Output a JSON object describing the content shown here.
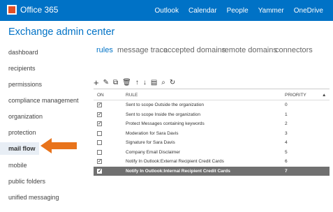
{
  "topbar": {
    "brand": "Office 365",
    "nav": [
      "Outlook",
      "Calendar",
      "People",
      "Yammer",
      "OneDrive"
    ]
  },
  "app_title": "Exchange admin center",
  "sidebar": {
    "items": [
      "dashboard",
      "recipients",
      "permissions",
      "compliance management",
      "organization",
      "protection",
      "mail flow",
      "mobile",
      "public folders",
      "unified messaging"
    ],
    "active": "mail flow"
  },
  "tabs": [
    "rules",
    "message trace",
    "accepted domains",
    "remote domains",
    "connectors"
  ],
  "toolbar": [
    "+",
    "✎",
    "⧉",
    "🗑",
    "↑",
    "↓",
    "▤",
    "⌕",
    "↻"
  ],
  "grid": {
    "headers": [
      "ON",
      "RULE",
      "PRIORITY"
    ],
    "rows": [
      {
        "on": true,
        "rule": "Sent to scope Outside the organization",
        "priority": "0"
      },
      {
        "on": true,
        "rule": "Sent to scope Inside the organization",
        "priority": "1"
      },
      {
        "on": true,
        "rule": "Protect Messages containing keywords",
        "priority": "2"
      },
      {
        "on": false,
        "rule": "Moderation for Sara Davis",
        "priority": "3"
      },
      {
        "on": false,
        "rule": "Signature for Sara Davis",
        "priority": "4"
      },
      {
        "on": false,
        "rule": "Company Email Disclaimer",
        "priority": "5"
      },
      {
        "on": true,
        "rule": "Notify In Outlook:External Recipient Credit Cards",
        "priority": "6"
      },
      {
        "on": true,
        "rule": "Notify In Outlook:Internal Recipient Credit Cards",
        "priority": "7"
      }
    ]
  },
  "colors": {
    "accent": "#0072c6",
    "arrow": "#e8731b",
    "selected_row": "#707070"
  }
}
